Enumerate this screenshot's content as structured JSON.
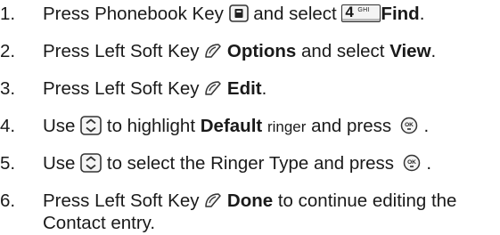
{
  "steps": [
    {
      "number": "1.",
      "before": "Press Phonebook Key",
      "middle": "and select",
      "key_digit": "4",
      "key_letters": "GHI",
      "bold": "Find",
      "after": "."
    },
    {
      "number": "2.",
      "before": "Press Left Soft Key",
      "bold1": "Options",
      "middle": "and select",
      "bold2": "View",
      "after": "."
    },
    {
      "number": "3.",
      "before": "Press Left Soft Key",
      "bold": "Edit",
      "after": "."
    },
    {
      "number": "4.",
      "before": "Use",
      "middle": "to highlight",
      "bold": "Default",
      "small": "ringer",
      "after": "and press",
      "end": "."
    },
    {
      "number": "5.",
      "before": "Use",
      "middle": "to select the Ringer Type and press",
      "end": "."
    },
    {
      "number": "6.",
      "before": "Press Left Soft Key",
      "bold": "Done",
      "after": "to continue editing the",
      "line2": "Contact entry."
    }
  ],
  "icons": {
    "phonebook_key": "phonebook-key-icon",
    "number_key": "4-ghi-key-icon",
    "left_soft_key": "left-soft-key-icon",
    "nav_key": "directional-key-icon",
    "ok_key": "ok-key-icon",
    "ok_key_label": "OK"
  }
}
